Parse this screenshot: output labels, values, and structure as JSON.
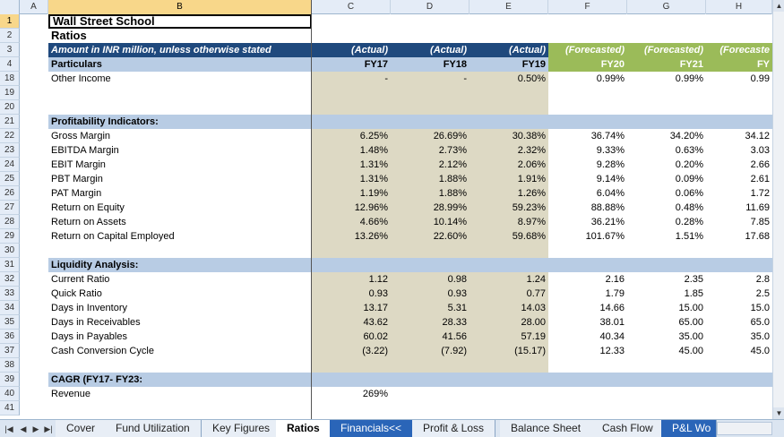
{
  "columns": {
    "headers": [
      "A",
      "B",
      "C",
      "D",
      "E",
      "F",
      "G",
      "H"
    ],
    "selected": "B"
  },
  "rows": {
    "r1": {
      "num": "1",
      "b": "Wall Street School"
    },
    "r2": {
      "num": "2",
      "b": "Ratios"
    },
    "r3": {
      "num": "3",
      "b": "Amount in INR million, unless otherwise stated",
      "c": "(Actual)",
      "d": "(Actual)",
      "e": "(Actual)",
      "f": "(Forecasted)",
      "g": "(Forecasted)",
      "h": "(Forecaste"
    },
    "r4": {
      "num": "4",
      "b": "Particulars",
      "c": "FY17",
      "d": "FY18",
      "e": "FY19",
      "f": "FY20",
      "g": "FY21",
      "h": "FY"
    },
    "r18": {
      "num": "18",
      "b": "Other Income",
      "c": "-",
      "d": "-",
      "e": "0.50%",
      "f": "0.99%",
      "g": "0.99%",
      "h": "0.99"
    },
    "r19": {
      "num": "19"
    },
    "r20": {
      "num": "20"
    },
    "r21": {
      "num": "21",
      "b": "Profitability Indicators:"
    },
    "r22": {
      "num": "22",
      "b": "Gross Margin",
      "c": "6.25%",
      "d": "26.69%",
      "e": "30.38%",
      "f": "36.74%",
      "g": "34.20%",
      "h": "34.12"
    },
    "r23": {
      "num": "23",
      "b": "EBITDA Margin",
      "c": "1.48%",
      "d": "2.73%",
      "e": "2.32%",
      "f": "9.33%",
      "g": "0.63%",
      "h": "3.03"
    },
    "r24": {
      "num": "24",
      "b": "EBIT Margin",
      "c": "1.31%",
      "d": "2.12%",
      "e": "2.06%",
      "f": "9.28%",
      "g": "0.20%",
      "h": "2.66"
    },
    "r25": {
      "num": "25",
      "b": "PBT Margin",
      "c": "1.31%",
      "d": "1.88%",
      "e": "1.91%",
      "f": "9.14%",
      "g": "0.09%",
      "h": "2.61"
    },
    "r26": {
      "num": "26",
      "b": "PAT Margin",
      "c": "1.19%",
      "d": "1.88%",
      "e": "1.26%",
      "f": "6.04%",
      "g": "0.06%",
      "h": "1.72"
    },
    "r27": {
      "num": "27",
      "b": "Return on Equity",
      "c": "12.96%",
      "d": "28.99%",
      "e": "59.23%",
      "f": "88.88%",
      "g": "0.48%",
      "h": "11.69"
    },
    "r28": {
      "num": "28",
      "b": "Return on Assets",
      "c": "4.66%",
      "d": "10.14%",
      "e": "8.97%",
      "f": "36.21%",
      "g": "0.28%",
      "h": "7.85"
    },
    "r29": {
      "num": "29",
      "b": "Return on Capital Employed",
      "c": "13.26%",
      "d": "22.60%",
      "e": "59.68%",
      "f": "101.67%",
      "g": "1.51%",
      "h": "17.68"
    },
    "r30": {
      "num": "30"
    },
    "r31": {
      "num": "31",
      "b": "Liquidity Analysis:"
    },
    "r32": {
      "num": "32",
      "b": "Current Ratio",
      "c": "1.12",
      "d": "0.98",
      "e": "1.24",
      "f": "2.16",
      "g": "2.35",
      "h": "2.8"
    },
    "r33": {
      "num": "33",
      "b": "Quick Ratio",
      "c": "0.93",
      "d": "0.93",
      "e": "0.77",
      "f": "1.79",
      "g": "1.85",
      "h": "2.5"
    },
    "r34": {
      "num": "34",
      "b": "Days in Inventory",
      "c": "13.17",
      "d": "5.31",
      "e": "14.03",
      "f": "14.66",
      "g": "15.00",
      "h": "15.0"
    },
    "r35": {
      "num": "35",
      "b": "Days in Receivables",
      "c": "43.62",
      "d": "28.33",
      "e": "28.00",
      "f": "38.01",
      "g": "65.00",
      "h": "65.0"
    },
    "r36": {
      "num": "36",
      "b": "Days in Payables",
      "c": "60.02",
      "d": "41.56",
      "e": "57.19",
      "f": "40.34",
      "g": "35.00",
      "h": "35.0"
    },
    "r37": {
      "num": "37",
      "b": "Cash Conversion Cycle",
      "c": "(3.22)",
      "d": "(7.92)",
      "e": "(15.17)",
      "f": "12.33",
      "g": "45.00",
      "h": "45.0"
    },
    "r38": {
      "num": "38"
    },
    "r39": {
      "num": "39",
      "b": "CAGR (FY17- FY23:"
    },
    "r40": {
      "num": "40",
      "b": "Revenue",
      "c": "269%"
    },
    "r41": {
      "num": "41"
    }
  },
  "tabs": {
    "cover": "Cover",
    "fund": "Fund Utilization",
    "key": "Key Figures",
    "ratios": "Ratios",
    "financials": "Financials<<",
    "pl": "Profit & Loss",
    "bs": "Balance Sheet",
    "cf": "Cash Flow",
    "plw": "P&L Wo"
  },
  "nav": {
    "first": "|◀",
    "prev": "◀",
    "next": "▶",
    "last": "▶|"
  },
  "scroll": {
    "up": "▲",
    "down": "▼"
  },
  "colors": {
    "header_dark": "#1f497d",
    "section_blue": "#b8cce4",
    "forecast_green": "#9bbb59",
    "actual_beige": "#ddd9c4"
  }
}
